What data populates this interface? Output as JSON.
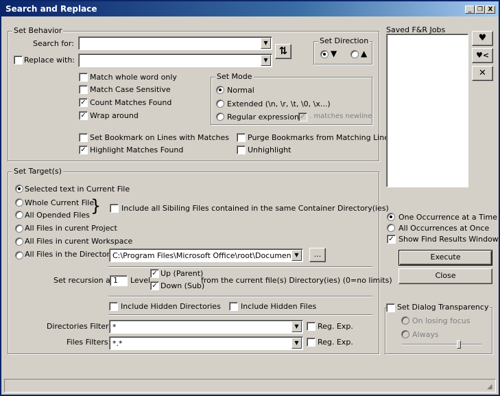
{
  "window": {
    "title": "Search and Replace",
    "min": "_",
    "max": "❐",
    "close": "X"
  },
  "behavior": {
    "legend": "Set Behavior",
    "search_label": "Search for:",
    "search_value": "",
    "replace_label": "Replace with:",
    "replace_value": "",
    "swap_glyph": "⇅",
    "match_whole_word": "Match whole word only",
    "match_case": "Match Case Sensitive",
    "count_matches": "Count Matches Found",
    "wrap_around": "Wrap around",
    "set_bookmark": "Set Bookmark on Lines with Matches",
    "highlight_matches": "Highlight Matches Found",
    "purge_bookmarks": "Purge Bookmarks from Matching Lines",
    "unhighlight": "Unhighlight"
  },
  "direction": {
    "legend": "Set Direction",
    "down": "▼",
    "up": "▲"
  },
  "mode": {
    "legend": "Set Mode",
    "normal": "Normal",
    "extended": "Extended (\\n, \\r, \\t, \\0, \\x...)",
    "regex": "Regular expression",
    "matches_newline": ". matches newline"
  },
  "target": {
    "legend": "Set Target(s)",
    "selected_text": "Selected text in Current File",
    "whole_file": "Whole Current File",
    "opened_files": "All Opended Files",
    "include_siblings": "Include all Sibiling Files contained in the same Container Directory(ies)",
    "project": "All Files in curent Project",
    "workspace": "All Files in curent Workspace",
    "directory": "All Files in the Directory:",
    "directory_value": "C:\\Program Files\\Microsoft Office\\root\\Document Then",
    "browse": "...",
    "recursion_label": "Set recursion at:",
    "recursion_value": "1",
    "level": "Level",
    "up_parent": "Up (Parent)",
    "down_sub": "Down (Sub)",
    "from_current": "from the current file(s) Directory(ies) (0=no limits)",
    "hidden_dirs": "Include Hidden Directories",
    "hidden_files": "Include Hidden Files",
    "dir_filters_label": "Directories Filters:",
    "dir_filters_value": "*",
    "file_filters_label": "Files Filters:",
    "file_filters_value": "*.*",
    "reg_exp": "Reg. Exp."
  },
  "saved": {
    "title": "Saved F&R Jobs",
    "save": "♥",
    "load": "♥<",
    "delete": "✕"
  },
  "occurrence": {
    "one": "One Occurrence at a Time",
    "all": "All Occurrences at Once",
    "show_results": "Show Find Results Window"
  },
  "actions": {
    "execute": "Execute",
    "close": "Close"
  },
  "transparency": {
    "legend": "Set Dialog Transparency",
    "on_losing_focus": "On losing focus",
    "always": "Always"
  }
}
